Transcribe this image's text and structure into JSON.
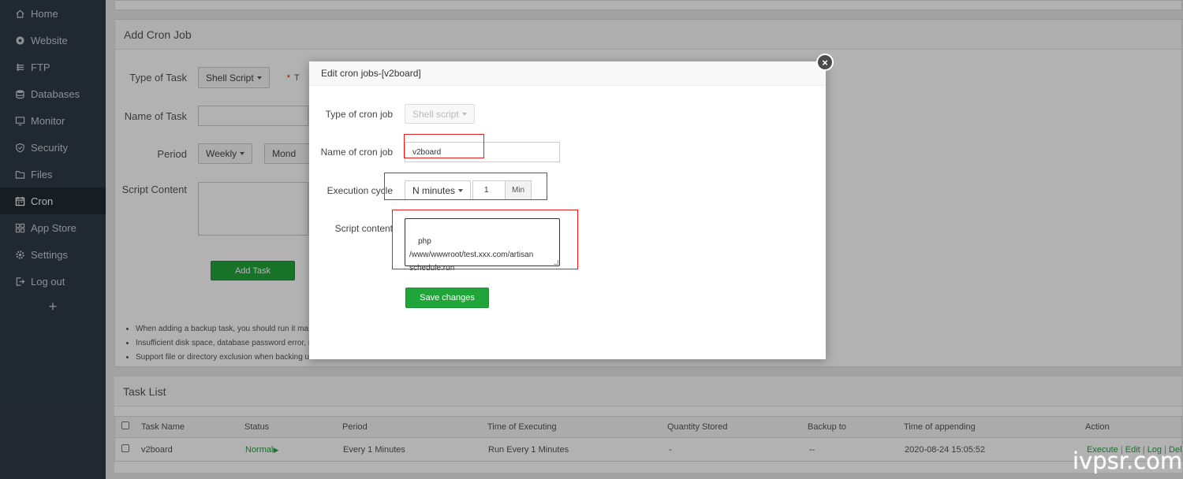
{
  "sidebar": {
    "items": [
      {
        "label": "Home",
        "icon": "home-icon"
      },
      {
        "label": "Website",
        "icon": "globe-icon"
      },
      {
        "label": "FTP",
        "icon": "ftp-icon"
      },
      {
        "label": "Databases",
        "icon": "database-icon"
      },
      {
        "label": "Monitor",
        "icon": "monitor-icon"
      },
      {
        "label": "Security",
        "icon": "shield-icon"
      },
      {
        "label": "Files",
        "icon": "folder-icon"
      },
      {
        "label": "Cron",
        "icon": "calendar-icon",
        "active": true
      },
      {
        "label": "App Store",
        "icon": "grid-icon"
      },
      {
        "label": "Settings",
        "icon": "gear-icon"
      },
      {
        "label": "Log out",
        "icon": "logout-icon"
      }
    ],
    "add": "+"
  },
  "add_cron": {
    "title": "Add Cron Job",
    "type_label": "Type of Task",
    "type_value": "Shell Script",
    "star": "*",
    "star_text": "T",
    "name_label": "Name of Task",
    "period_label": "Period",
    "period_value": "Weekly",
    "day_value": "Mond",
    "script_label": "Script Content",
    "add_button": "Add Task",
    "notes": [
      "When adding a backup task, you should run it ma",
      "Insufficient disk space, database password error, n",
      "Support file or directory exclusion when backing u"
    ]
  },
  "task_list": {
    "title": "Task List",
    "columns": [
      "Task Name",
      "Status",
      "Period",
      "Time of Executing",
      "Quantity Stored",
      "Backup to",
      "Time of appending",
      "Action"
    ],
    "rows": [
      {
        "name": "v2board",
        "status": "Normal",
        "status_arrow": "▶",
        "period": "Every 1 Minutes",
        "executing": "Run Every 1 Minutes",
        "stored": "-",
        "backup": "--",
        "appended": "2020-08-24 15:05:52",
        "actions": [
          "Execute",
          "Edit",
          "Log",
          "Del"
        ],
        "separator": "|"
      }
    ]
  },
  "modal": {
    "title": "Edit cron jobs-[v2board]",
    "close": "×",
    "type_label": "Type of cron job",
    "type_value": "Shell script",
    "name_label": "Name of cron job",
    "name_value": "v2board",
    "cycle_label": "Execution cycle",
    "cycle_value": "N minutes",
    "cycle_number": "1",
    "cycle_unit": "Min",
    "script_label": "Script content",
    "script_value": "php /www/wwwroot/test.xxx.com/artisan\nschedule:run",
    "save_button": "Save changes"
  },
  "colors": {
    "sidebar_bg": "#2f3a45",
    "accent_green": "#20a53a",
    "highlight_red": "#e02020"
  },
  "watermark": "ivpsr.com"
}
